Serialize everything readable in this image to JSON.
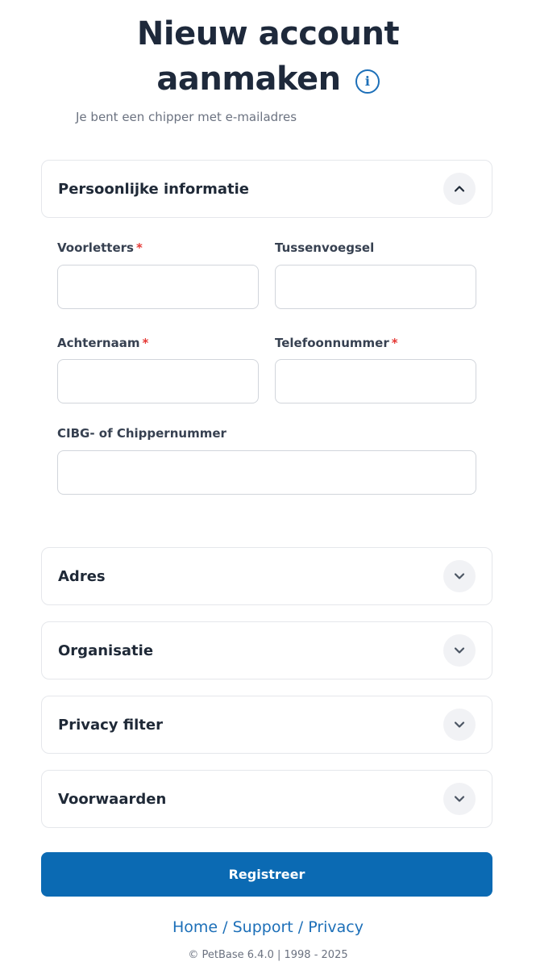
{
  "header": {
    "title_line1": "Nieuw account",
    "title_line2": "aanmaken",
    "subtitle": "Je bent een chipper met e-mailadres"
  },
  "sections": {
    "personal": {
      "title": "Persoonlijke informatie",
      "expanded": true
    },
    "address": {
      "title": "Adres",
      "expanded": false
    },
    "organisation": {
      "title": "Organisatie",
      "expanded": false
    },
    "privacy": {
      "title": "Privacy filter",
      "expanded": false
    },
    "terms": {
      "title": "Voorwaarden",
      "expanded": false
    }
  },
  "fields": {
    "initials": {
      "label": "Voorletters",
      "required_mark": "*",
      "value": ""
    },
    "infix": {
      "label": "Tussenvoegsel",
      "value": ""
    },
    "lastname": {
      "label": "Achternaam",
      "required_mark": "*",
      "value": ""
    },
    "phone": {
      "label": "Telefoonnummer",
      "required_mark": "*",
      "value": ""
    },
    "cibg": {
      "label": "CIBG- of Chippernummer",
      "value": ""
    }
  },
  "register_label": "Registreer",
  "footer": {
    "home": "Home",
    "support": "Support",
    "privacy": "Privacy",
    "separator": "/",
    "copyright": "© PetBase 6.4.0 | 1998 - 2025"
  },
  "icons": {
    "info": "info-icon",
    "chevron_up": "chevron-up-icon",
    "chevron_down": "chevron-down-icon"
  },
  "colors": {
    "primary": "#0b6ab3",
    "link": "#1c6fb8",
    "required": "#e53935"
  }
}
